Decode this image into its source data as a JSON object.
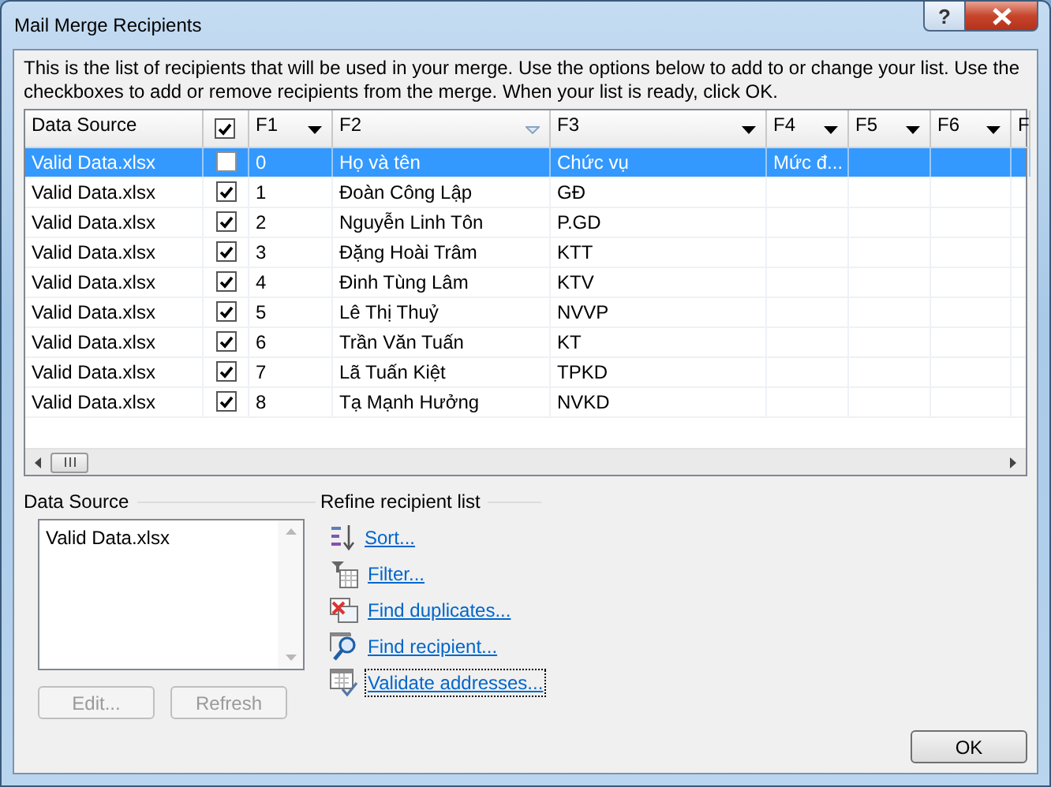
{
  "window": {
    "title": "Mail Merge Recipients",
    "help_glyph": "?"
  },
  "description": "This is the list of recipients that will be used in your merge.  Use the options below to add to or change your list.  Use the checkboxes to add or remove recipients from the merge.  When your list is ready, click OK.",
  "table": {
    "columns": [
      {
        "kind": "text",
        "label": "Data Source"
      },
      {
        "kind": "checkbox",
        "checked": true
      },
      {
        "kind": "dropdown",
        "label": "F1"
      },
      {
        "kind": "sorted",
        "label": "F2"
      },
      {
        "kind": "dropdown",
        "label": "F3"
      },
      {
        "kind": "dropdown",
        "label": "F4"
      },
      {
        "kind": "dropdown",
        "label": "F5"
      },
      {
        "kind": "dropdown",
        "label": "F6"
      },
      {
        "kind": "plain",
        "label": "F"
      }
    ],
    "rows": [
      {
        "selected": true,
        "checked": false,
        "cells": [
          "Valid Data.xlsx",
          "",
          "0",
          "Họ và tên",
          "Chức vụ",
          "Mức đ..."
        ]
      },
      {
        "selected": false,
        "checked": true,
        "cells": [
          "Valid Data.xlsx",
          "",
          "1",
          "Đoàn Công Lập",
          "GĐ"
        ]
      },
      {
        "selected": false,
        "checked": true,
        "cells": [
          "Valid Data.xlsx",
          "",
          "2",
          "Nguyễn Linh Tôn",
          "P.GD"
        ]
      },
      {
        "selected": false,
        "checked": true,
        "cells": [
          "Valid Data.xlsx",
          "",
          "3",
          "Đặng Hoài Trâm",
          "KTT"
        ]
      },
      {
        "selected": false,
        "checked": true,
        "cells": [
          "Valid Data.xlsx",
          "",
          "4",
          "Đinh Tùng Lâm",
          "KTV"
        ]
      },
      {
        "selected": false,
        "checked": true,
        "cells": [
          "Valid Data.xlsx",
          "",
          "5",
          "Lê Thị Thuỷ",
          "NVVP"
        ]
      },
      {
        "selected": false,
        "checked": true,
        "cells": [
          "Valid Data.xlsx",
          "",
          "6",
          "Trần Văn Tuấn",
          "KT"
        ]
      },
      {
        "selected": false,
        "checked": true,
        "cells": [
          "Valid Data.xlsx",
          "",
          "7",
          "Lã Tuấn Kiệt",
          "TPKD"
        ]
      },
      {
        "selected": false,
        "checked": true,
        "cells": [
          "Valid Data.xlsx",
          "",
          "8",
          "Tạ Mạnh Hưởng",
          "NVKD"
        ]
      }
    ]
  },
  "data_source": {
    "heading": "Data Source",
    "items": [
      {
        "label": "Valid Data.xlsx",
        "selected": false
      }
    ],
    "buttons": [
      {
        "label": "Edit...",
        "disabled": true
      },
      {
        "label": "Refresh",
        "disabled": true
      }
    ]
  },
  "refine": {
    "heading": "Refine recipient list",
    "links": [
      {
        "kind": "sort",
        "label": "Sort...",
        "focused": false
      },
      {
        "kind": "filter",
        "label": "Filter...",
        "focused": false
      },
      {
        "kind": "duplicates",
        "label": "Find duplicates...",
        "focused": false
      },
      {
        "kind": "find",
        "label": "Find recipient...",
        "focused": false
      },
      {
        "kind": "validate",
        "label": "Validate addresses...",
        "focused": true
      }
    ]
  },
  "buttons": [
    {
      "label": "OK",
      "disabled": false
    }
  ]
}
